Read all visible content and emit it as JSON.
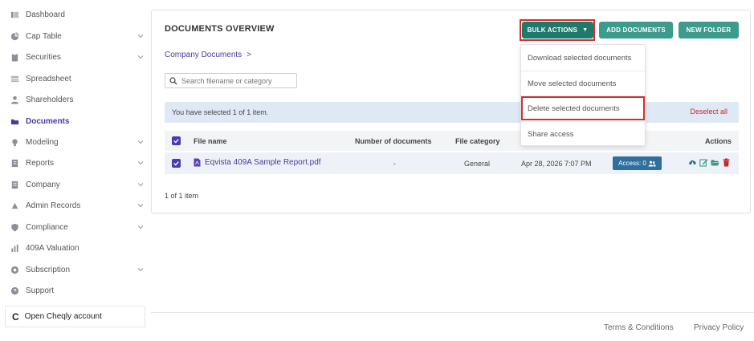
{
  "sidebar": {
    "items": [
      {
        "label": "Dashboard",
        "icon": "dashboard-icon",
        "chevron": false,
        "active": false
      },
      {
        "label": "Cap Table",
        "icon": "pie-chart-icon",
        "chevron": true,
        "active": false
      },
      {
        "label": "Securities",
        "icon": "clipboard-icon",
        "chevron": true,
        "active": false
      },
      {
        "label": "Spreadsheet",
        "icon": "table-icon",
        "chevron": false,
        "active": false
      },
      {
        "label": "Shareholders",
        "icon": "person-icon",
        "chevron": false,
        "active": false
      },
      {
        "label": "Documents",
        "icon": "folder-icon",
        "chevron": false,
        "active": true
      },
      {
        "label": "Modeling",
        "icon": "lightbulb-icon",
        "chevron": true,
        "active": false
      },
      {
        "label": "Reports",
        "icon": "report-icon",
        "chevron": true,
        "active": false
      },
      {
        "label": "Company",
        "icon": "building-icon",
        "chevron": true,
        "active": false
      },
      {
        "label": "Admin Records",
        "icon": "admin-icon",
        "chevron": true,
        "active": false
      },
      {
        "label": "Compliance",
        "icon": "shield-icon",
        "chevron": true,
        "active": false
      },
      {
        "label": "409A Valuation",
        "icon": "chart-icon",
        "chevron": false,
        "active": false
      },
      {
        "label": "Subscription",
        "icon": "subscription-icon",
        "chevron": true,
        "active": false
      },
      {
        "label": "Support",
        "icon": "support-icon",
        "chevron": false,
        "active": false
      }
    ],
    "cheqly": {
      "logo": "C",
      "label": "Open Cheqly account"
    }
  },
  "main": {
    "title": "DOCUMENTS OVERVIEW",
    "buttons": {
      "bulk_actions": "BULK ACTIONS",
      "add_documents": "ADD DOCUMENTS",
      "new_folder": "NEW FOLDER"
    },
    "breadcrumb": {
      "label": "Company Documents",
      "separator": ">"
    },
    "search": {
      "placeholder": "Search filename or category",
      "value": ""
    },
    "selection": {
      "message": "You have selected 1 of 1 item.",
      "deselect_label": "Deselect all"
    },
    "table": {
      "columns": [
        "File name",
        "Number of documents",
        "File category",
        "Actions"
      ],
      "rows": [
        {
          "checked": true,
          "file_name": "Eqvista 409A Sample Report.pdf",
          "number_of_documents": "-",
          "file_category": "General",
          "date": "Apr 28, 2026 7:07 PM",
          "access": "Access: 0",
          "action_icons": [
            "cloud-download-icon",
            "edit-icon",
            "folder-open-icon",
            "trash-icon"
          ]
        }
      ]
    },
    "item_count": "1 of 1 item"
  },
  "dropdown": {
    "items": [
      "Download selected documents",
      "Move selected documents",
      "Delete selected documents",
      "Share access"
    ],
    "highlighted_index": 2
  },
  "footer": {
    "terms": "Terms & Conditions",
    "privacy": "Privacy Policy"
  },
  "colors": {
    "primary_teal": "#1f7a6e",
    "secondary_teal": "#3c9b8c",
    "brand_purple": "#4b3a9e",
    "highlight_red": "#d32f2f",
    "access_blue": "#2e6f9e"
  }
}
